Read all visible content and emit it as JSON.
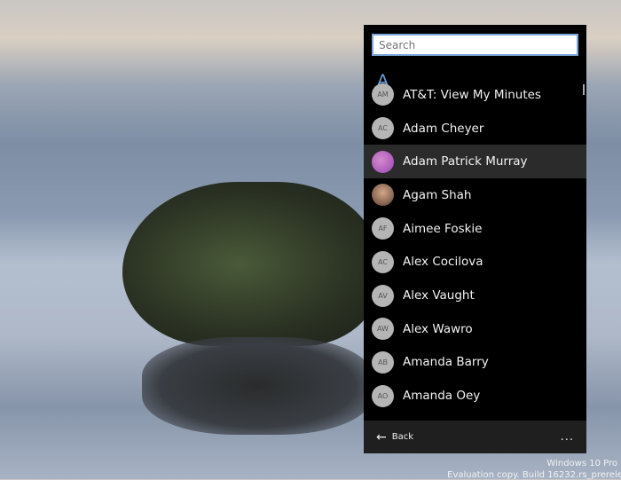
{
  "search": {
    "placeholder": "Search"
  },
  "section_letter": "A",
  "contacts": [
    {
      "initials": "AM",
      "name": "AT&T: View My Minutes"
    },
    {
      "initials": "AC",
      "name": "Adam Cheyer"
    },
    {
      "initials": "",
      "name": "Adam Patrick Murray",
      "photo": true,
      "selected": true
    },
    {
      "initials": "",
      "name": "Agam Shah",
      "photo": true
    },
    {
      "initials": "AF",
      "name": "Aimee Foskie"
    },
    {
      "initials": "AC",
      "name": "Alex Cocilova"
    },
    {
      "initials": "AV",
      "name": "Alex Vaught"
    },
    {
      "initials": "AW",
      "name": "Alex Wawro"
    },
    {
      "initials": "AB",
      "name": "Amanda Barry"
    },
    {
      "initials": "AO",
      "name": "Amanda Oey"
    }
  ],
  "footer": {
    "back_label": "Back",
    "more_label": "..."
  },
  "watermark": {
    "line1": "Windows 10 Pro",
    "line2": "Evaluation copy. Build 16232.rs_prerelea"
  },
  "colors": {
    "accent": "#6aa3e0",
    "panel": "#000000",
    "footer": "#1f1f1f",
    "selected_row": "#2b2b2b"
  }
}
